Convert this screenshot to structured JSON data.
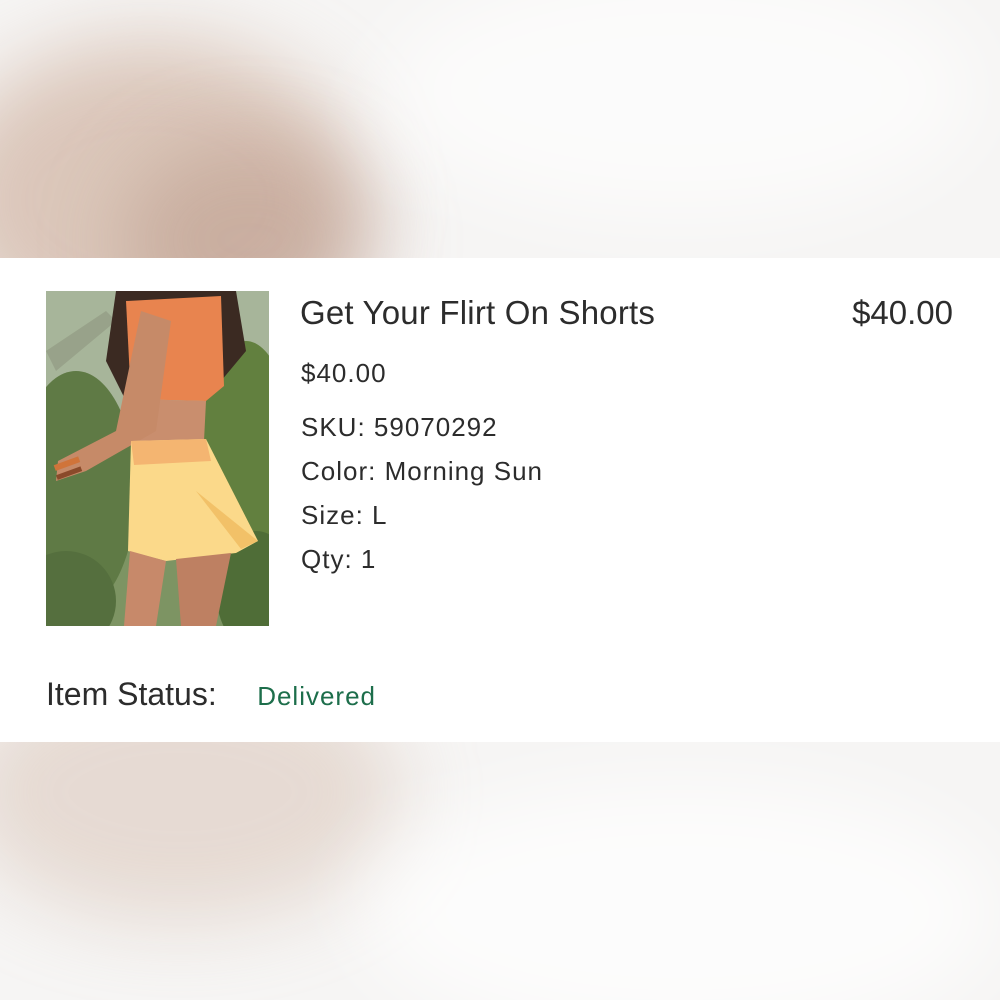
{
  "product": {
    "title": "Get Your Flirt On Shorts",
    "line_total": "$40.00",
    "unit_price": "$40.00",
    "sku": "SKU: 59070292",
    "color": "Color: Morning Sun",
    "size": "Size: L",
    "qty": "Qty: 1"
  },
  "status": {
    "label": "Item Status:",
    "value": "Delivered",
    "value_color": "#1d6e4b"
  }
}
